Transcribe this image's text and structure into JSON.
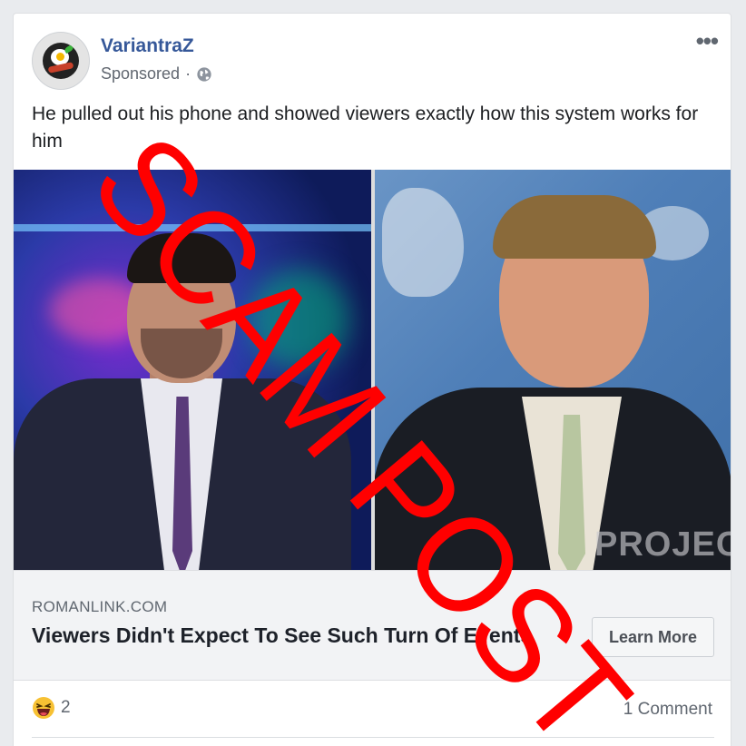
{
  "post": {
    "page_name": "VariantraZ",
    "sponsored_label": "Sponsored",
    "separator": "·",
    "text": "He pulled out his phone and showed viewers exactly how this system works for him"
  },
  "media": {
    "overlay_text": "PROJECT"
  },
  "link": {
    "domain": "ROMANLINK.COM",
    "headline": "Viewers Didn't Expect To See Such Turn Of Events",
    "cta_label": "Learn More"
  },
  "engagement": {
    "reaction_count": "2",
    "comment_count": "1 Comment"
  },
  "stamp": {
    "text": "SCAM POST",
    "color": "#ff0000"
  },
  "icons": {
    "more": "more-options-icon",
    "audience": "globe-icon",
    "reaction": "haha-emoji-icon"
  }
}
